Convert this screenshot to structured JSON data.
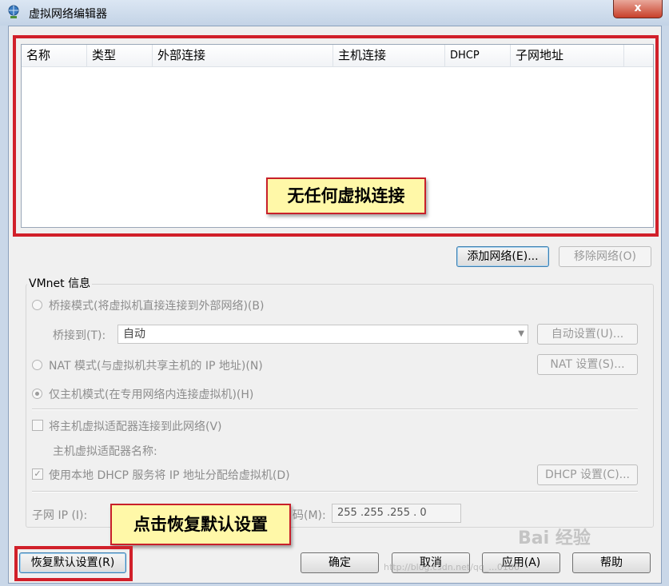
{
  "window": {
    "title": "虚拟网络编辑器",
    "close_label": "x"
  },
  "table": {
    "columns": [
      "名称",
      "类型",
      "外部连接",
      "主机连接",
      "DHCP",
      "子网地址"
    ],
    "rows": []
  },
  "annotations": {
    "no_connection": "无任何虚拟连接",
    "click_restore": "点击恢复默认设置"
  },
  "buttons": {
    "add_network": "添加网络(E)...",
    "remove_network": "移除网络(O)",
    "auto_settings": "自动设置(U)...",
    "nat_settings": "NAT 设置(S)...",
    "dhcp_settings": "DHCP 设置(C)...",
    "restore_defaults": "恢复默认设置(R)",
    "ok": "确定",
    "cancel": "取消",
    "apply": "应用(A)",
    "help": "帮助"
  },
  "vmnet": {
    "group_title": "VMnet 信息",
    "bridged_label": "桥接模式(将虚拟机直接连接到外部网络)(B)",
    "bridged_to_label": "桥接到(T):",
    "bridged_to_value": "自动",
    "nat_label": "NAT 模式(与虚拟机共享主机的 IP 地址)(N)",
    "hostonly_label": "仅主机模式(在专用网络内连接虚拟机)(H)",
    "selected_mode": "hostonly",
    "connect_adapter_label": "将主机虚拟适配器连接到此网络(V)",
    "connect_adapter_checked": false,
    "adapter_name_label": "主机虚拟适配器名称:",
    "dhcp_label": "使用本地 DHCP 服务将 IP 地址分配给虚拟机(D)",
    "dhcp_checked": true,
    "subnet_ip_label": "子网 IP (I):",
    "subnet_mask_label_fragment": "码(M):",
    "subnet_mask_value": "255 .255 .255 . 0"
  },
  "watermark": {
    "logo_text": "Bai 经验",
    "url_text": "http://blog.csdn.net/qq_...0186"
  },
  "colors": {
    "highlight_red": "#d1202a",
    "callout_fill": "#fff8a8"
  }
}
